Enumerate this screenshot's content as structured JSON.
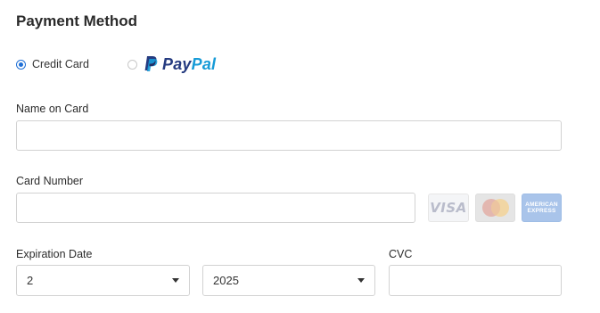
{
  "title": "Payment Method",
  "payment_methods": {
    "credit_card": {
      "label": "Credit Card",
      "selected": true
    },
    "paypal": {
      "label_pay": "Pay",
      "label_pal": "Pal",
      "selected": false
    }
  },
  "fields": {
    "name_on_card": {
      "label": "Name on Card",
      "value": "",
      "placeholder": ""
    },
    "card_number": {
      "label": "Card Number",
      "value": "",
      "placeholder": ""
    },
    "expiration": {
      "label": "Expiration Date",
      "month": "2",
      "year": "2025"
    },
    "cvc": {
      "label": "CVC",
      "value": "",
      "placeholder": ""
    }
  },
  "card_logos": {
    "visa": "VISA",
    "amex_line1": "AMERICAN",
    "amex_line2": "EXPRESS"
  },
  "colors": {
    "radio_accent": "#1f6fd6",
    "paypal_dark": "#253b80",
    "paypal_light": "#179bd7"
  }
}
